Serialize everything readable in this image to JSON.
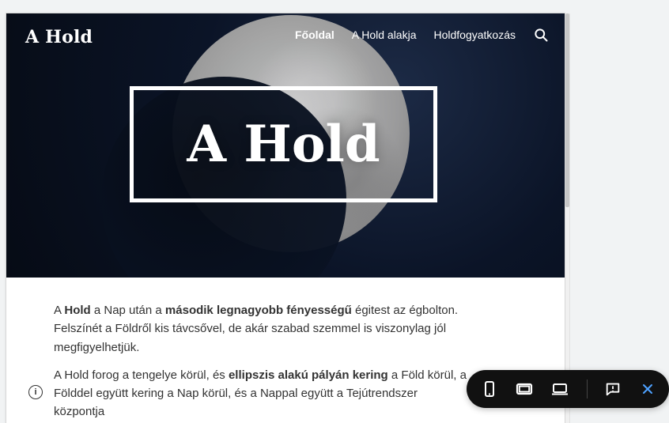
{
  "site": {
    "brand": "A Hold",
    "nav": [
      "Főoldal",
      "A Hold alakja",
      "Holdfogyatkozás"
    ],
    "hero_title": "A Hold"
  },
  "content": {
    "p1": {
      "pre": "A ",
      "bold1": "Hold",
      "mid1": " a Nap után a ",
      "bold2": "második legnagyobb fényességű",
      "post": " égitest az égbolton. Felszínét a Földről kis távcsővel, de akár szabad szemmel is viszonylag jól megfigyelhetjük."
    },
    "p2": {
      "pre": "A Hold forog a tengelye körül, és ",
      "bold": "ellipszis alakú pályán kering",
      "post": " a Föld körül, a Földdel együtt kering a Nap körül, és a Nappal együtt a Tejútrendszer központja"
    }
  },
  "colors": {
    "toolbar_bg": "#111111",
    "accent_blue": "#4ea1ff"
  },
  "icons": {
    "search": "search-icon",
    "info": "info-icon",
    "phone": "phone-icon",
    "tablet": "tablet-icon",
    "laptop": "laptop-icon",
    "feedback": "feedback-icon",
    "close": "close-icon"
  }
}
